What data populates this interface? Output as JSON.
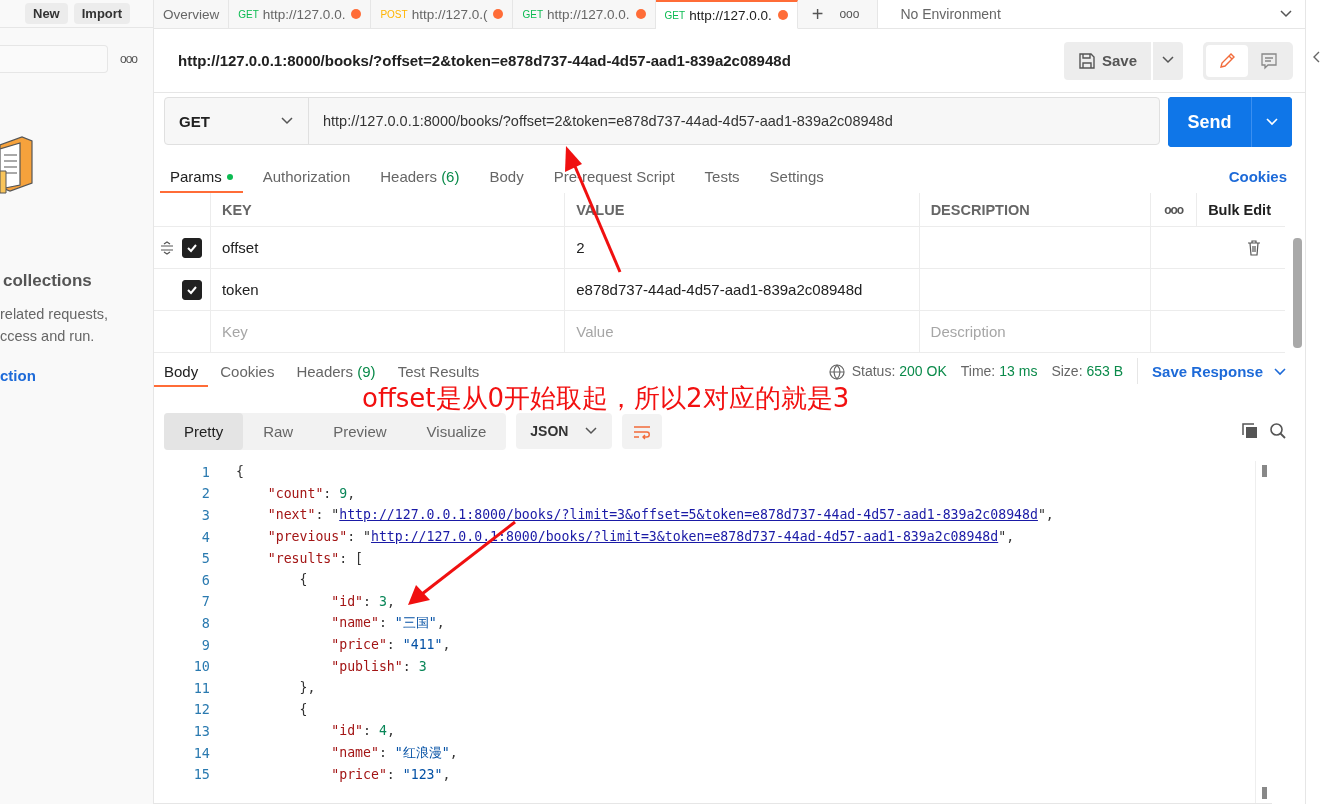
{
  "sidebar": {
    "buttons": [
      "New",
      "Import"
    ],
    "more": "ooo",
    "empty_state": {
      "heading": "collections",
      "lines": [
        "related requests,",
        "ccess and run."
      ],
      "link": "ction"
    }
  },
  "tabs": [
    {
      "label": "Overview",
      "selected": false
    },
    {
      "method": "GET",
      "label": "http://127.0.0.",
      "unsaved": true,
      "selected": false
    },
    {
      "method": "POST",
      "label": "http://127.0.(",
      "unsaved": true,
      "selected": false
    },
    {
      "method": "GET",
      "label": "http://127.0.0.",
      "unsaved": true,
      "selected": false
    },
    {
      "method": "GET",
      "label": "http://127.0.0.",
      "unsaved": true,
      "selected": true
    }
  ],
  "tab_actions": {
    "add": "+",
    "more": "ooo"
  },
  "environment": "No Environment",
  "request": {
    "title": "http://127.0.0.1:8000/books/?offset=2&token=e878d737-44ad-4d57-aad1-839a2c08948d",
    "save": "Save",
    "method": "GET",
    "url": "http://127.0.0.1:8000/books/?offset=2&token=e878d737-44ad-4d57-aad1-839a2c08948d",
    "send": "Send"
  },
  "request_tabs": [
    {
      "label": "Params",
      "badge_dot": true,
      "selected": true
    },
    {
      "label": "Authorization",
      "selected": false
    },
    {
      "label": "Headers",
      "count": "(6)",
      "selected": false
    },
    {
      "label": "Body",
      "selected": false
    },
    {
      "label": "Pre-request Script",
      "selected": false
    },
    {
      "label": "Tests",
      "selected": false
    },
    {
      "label": "Settings",
      "selected": false
    }
  ],
  "cookies_link": "Cookies",
  "params": {
    "columns": [
      "KEY",
      "VALUE",
      "DESCRIPTION"
    ],
    "more": "ooo",
    "bulk_edit": "Bulk Edit",
    "rows": [
      {
        "key": "offset",
        "value": "2",
        "checked": true
      },
      {
        "key": "token",
        "value": "e878d737-44ad-4d57-aad1-839a2c08948d",
        "checked": true
      }
    ],
    "placeholders": {
      "key": "Key",
      "value": "Value",
      "description": "Description"
    }
  },
  "response": {
    "tabs": [
      {
        "label": "Body",
        "selected": true
      },
      {
        "label": "Cookies",
        "selected": false
      },
      {
        "label": "Headers",
        "count": "(9)",
        "selected": false
      },
      {
        "label": "Test Results",
        "selected": false
      }
    ],
    "status_label": "Status:",
    "status": "200 OK",
    "time_label": "Time:",
    "time": "13 ms",
    "size_label": "Size:",
    "size": "653 B",
    "save_response": "Save Response",
    "views": [
      {
        "label": "Pretty",
        "selected": true
      },
      {
        "label": "Raw",
        "selected": false
      },
      {
        "label": "Preview",
        "selected": false
      },
      {
        "label": "Visualize",
        "selected": false
      }
    ],
    "format": "JSON",
    "lines": [
      [
        {
          "kind": "punct",
          "text": "{"
        }
      ],
      [
        {
          "kind": "key",
          "text": "    \"count\""
        },
        {
          "kind": "punct",
          "text": ": "
        },
        {
          "kind": "number",
          "text": "9"
        },
        {
          "kind": "punct",
          "text": ","
        }
      ],
      [
        {
          "kind": "key",
          "text": "    \"next\""
        },
        {
          "kind": "punct",
          "text": ": \""
        },
        {
          "kind": "link",
          "text": "http://127.0.0.1:8000/books/?limit=3&offset=5&token=e878d737-44ad-4d57-aad1-839a2c08948d"
        },
        {
          "kind": "punct",
          "text": "\","
        }
      ],
      [
        {
          "kind": "key",
          "text": "    \"previous\""
        },
        {
          "kind": "punct",
          "text": ": \""
        },
        {
          "kind": "link",
          "text": "http://127.0.0.1:8000/books/?limit=3&token=e878d737-44ad-4d57-aad1-839a2c08948d"
        },
        {
          "kind": "punct",
          "text": "\","
        }
      ],
      [
        {
          "kind": "key",
          "text": "    \"results\""
        },
        {
          "kind": "punct",
          "text": ": ["
        }
      ],
      [
        {
          "kind": "punct",
          "text": "        {"
        }
      ],
      [
        {
          "kind": "key",
          "text": "            \"id\""
        },
        {
          "kind": "punct",
          "text": ": "
        },
        {
          "kind": "number",
          "text": "3"
        },
        {
          "kind": "punct",
          "text": ","
        }
      ],
      [
        {
          "kind": "key",
          "text": "            \"name\""
        },
        {
          "kind": "punct",
          "text": ": "
        },
        {
          "kind": "string",
          "text": "\"三国\""
        },
        {
          "kind": "punct",
          "text": ","
        }
      ],
      [
        {
          "kind": "key",
          "text": "            \"price\""
        },
        {
          "kind": "punct",
          "text": ": "
        },
        {
          "kind": "string",
          "text": "\"411\""
        },
        {
          "kind": "punct",
          "text": ","
        }
      ],
      [
        {
          "kind": "key",
          "text": "            \"publish\""
        },
        {
          "kind": "punct",
          "text": ": "
        },
        {
          "kind": "number",
          "text": "3"
        }
      ],
      [
        {
          "kind": "punct",
          "text": "        },"
        }
      ],
      [
        {
          "kind": "punct",
          "text": "        {"
        }
      ],
      [
        {
          "kind": "key",
          "text": "            \"id\""
        },
        {
          "kind": "punct",
          "text": ": "
        },
        {
          "kind": "number",
          "text": "4"
        },
        {
          "kind": "punct",
          "text": ","
        }
      ],
      [
        {
          "kind": "key",
          "text": "            \"name\""
        },
        {
          "kind": "punct",
          "text": ": "
        },
        {
          "kind": "string",
          "text": "\"红浪漫\""
        },
        {
          "kind": "punct",
          "text": ","
        }
      ],
      [
        {
          "kind": "key",
          "text": "            \"price\""
        },
        {
          "kind": "punct",
          "text": ": "
        },
        {
          "kind": "string",
          "text": "\"123\""
        },
        {
          "kind": "punct",
          "text": ","
        }
      ]
    ],
    "line_numbers": [
      "1",
      "2",
      "3",
      "4",
      "5",
      "6",
      "7",
      "8",
      "9",
      "10",
      "11",
      "12",
      "13",
      "14",
      "15"
    ]
  },
  "annotation": {
    "text": "offset是从0开始取起，所以2对应的就是3"
  }
}
